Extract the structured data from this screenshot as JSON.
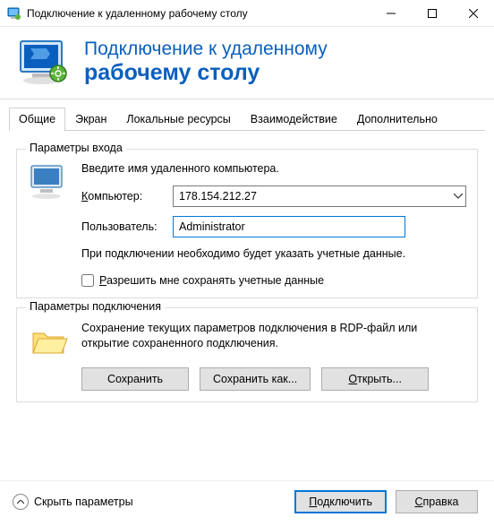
{
  "window": {
    "title": "Подключение к удаленному рабочему столу"
  },
  "header": {
    "line1": "Подключение к удаленному",
    "line2": "рабочему столу"
  },
  "tabs": {
    "general": "Общие",
    "display": "Экран",
    "local_resources": "Локальные ресурсы",
    "experience": "Взаимодействие",
    "advanced": "Дополнительно"
  },
  "login_group": {
    "title": "Параметры входа",
    "instruction": "Введите имя удаленного компьютера.",
    "computer_label_prefix": "К",
    "computer_label_rest": "омпьютер:",
    "computer_value": "178.154.212.27",
    "user_label": "Пользователь:",
    "user_value": "Administrator",
    "note": "При подключении необходимо будет указать учетные данные.",
    "checkbox_prefix": "Р",
    "checkbox_rest": "азрешить мне сохранять учетные данные"
  },
  "conn_group": {
    "title": "Параметры подключения",
    "note": "Сохранение текущих параметров подключения в RDP-файл или открытие сохраненного подключения.",
    "save": "Сохранить",
    "save_as": "Сохранить как...",
    "open_prefix": "О",
    "open_rest": "ткрыть..."
  },
  "footer": {
    "hide_params": "Скрыть параметры",
    "connect_prefix": "П",
    "connect_rest": "одключить",
    "help_prefix": "С",
    "help_rest": "правка"
  }
}
